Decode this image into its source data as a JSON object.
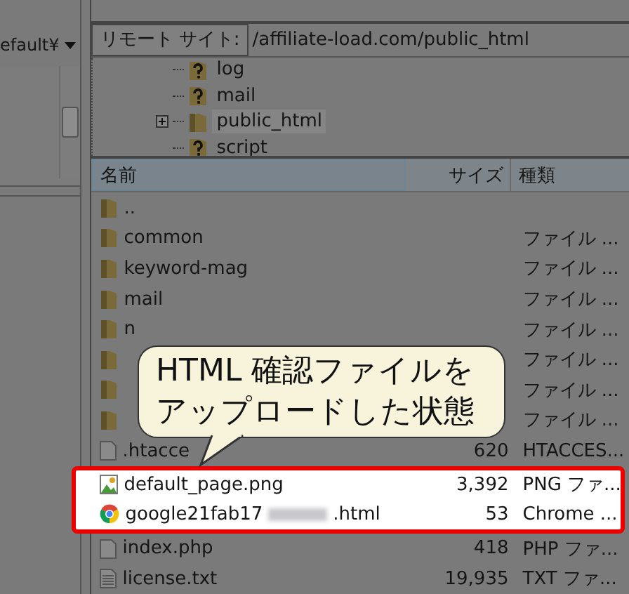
{
  "local_site": {
    "path": "efault¥"
  },
  "remote_site": {
    "label": "リモート サイト:",
    "path": "/affiliate-load.com/public_html"
  },
  "tree": [
    {
      "name": "log",
      "kind": "unknown",
      "expandable": false,
      "selected": false
    },
    {
      "name": "mail",
      "kind": "unknown",
      "expandable": false,
      "selected": false
    },
    {
      "name": "public_html",
      "kind": "folder",
      "expandable": true,
      "selected": true
    },
    {
      "name": "script",
      "kind": "unknown",
      "expandable": false,
      "selected": false
    }
  ],
  "columns": [
    {
      "label": "名前",
      "sorted": true
    },
    {
      "label": "サイズ",
      "sorted": false
    },
    {
      "label": "種類",
      "sorted": false
    }
  ],
  "files": [
    {
      "kind": "folder",
      "name": "..",
      "highlighted": false
    },
    {
      "kind": "folder",
      "name": "common",
      "type": "ファイル ...",
      "highlighted": false
    },
    {
      "kind": "folder",
      "name": "keyword-mag",
      "type": "ファイル ...",
      "highlighted": false
    },
    {
      "kind": "folder",
      "name": "mail",
      "type": "ファイル ...",
      "highlighted": false
    },
    {
      "kind": "folder",
      "name": "n",
      "type": "ファイル ...",
      "highlighted": false
    },
    {
      "kind": "folder",
      "type": "ファイル ...",
      "highlighted": false
    },
    {
      "kind": "folder",
      "type": "ファイル ...",
      "highlighted": false
    },
    {
      "kind": "folder",
      "type": "ファイル ...",
      "highlighted": false
    },
    {
      "kind": "file",
      "name": ".htacce",
      "size": "620",
      "type": "HTACCES...",
      "highlighted": false
    },
    {
      "kind": "image",
      "name": "default_page.png",
      "size": "3,392",
      "type": "PNG ファ...",
      "highlighted": true
    },
    {
      "kind": "chrome",
      "name": "google21fab17",
      "name_suffix": ".html",
      "redacted": true,
      "size": "53",
      "type": "Chrome ...",
      "highlighted": true
    },
    {
      "kind": "file",
      "name": "index.php",
      "size": "418",
      "type": "PHP ファ...",
      "highlighted": false
    },
    {
      "kind": "text",
      "name": "license.txt",
      "size": "19,935",
      "type": "TXT ファ...",
      "highlighted": false
    }
  ],
  "callout": {
    "lines": [
      "HTML 確認ファイルを",
      "アップロードした状態"
    ]
  }
}
